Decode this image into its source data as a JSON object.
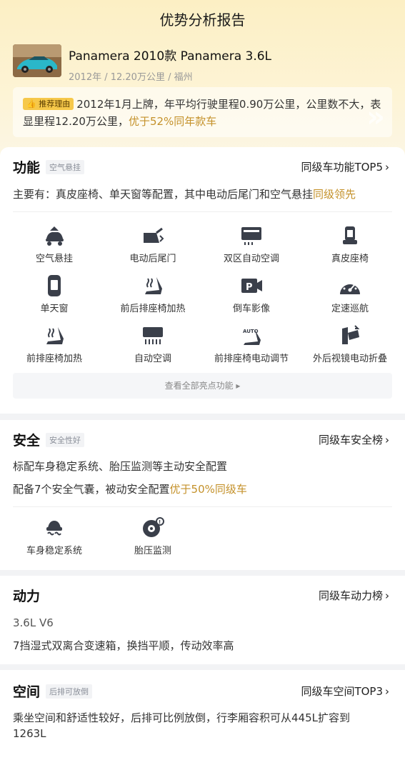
{
  "page": {
    "title": "优势分析报告"
  },
  "car": {
    "name": "Panamera 2010款 Panamera 3.6L",
    "meta": "2012年 / 12.20万公里 / 福州"
  },
  "reason": {
    "tag": "推荐理由",
    "text": "2012年1月上牌，年平均行驶里程0.90万公里，公里数不大，表显里程12.20万公里，",
    "highlight": "优于52%同年款车"
  },
  "features": {
    "title": "功能",
    "tag": "空气悬挂",
    "link": "同级车功能TOP5",
    "summary_prefix": "主要有：真皮座椅、单天窗等配置，其中电动后尾门和空气悬挂",
    "summary_highlight": "同级领先",
    "items": [
      {
        "label": "空气悬挂",
        "icon": "air-suspension-icon"
      },
      {
        "label": "电动后尾门",
        "icon": "power-tailgate-icon"
      },
      {
        "label": "双区自动空调",
        "icon": "dual-zone-ac-icon"
      },
      {
        "label": "真皮座椅",
        "icon": "leather-seat-icon"
      },
      {
        "label": "单天窗",
        "icon": "sunroof-icon"
      },
      {
        "label": "前后排座椅加热",
        "icon": "seat-heating-icon"
      },
      {
        "label": "倒车影像",
        "icon": "reverse-camera-icon"
      },
      {
        "label": "定速巡航",
        "icon": "cruise-control-icon"
      },
      {
        "label": "前排座椅加热",
        "icon": "front-seat-heating-icon"
      },
      {
        "label": "自动空调",
        "icon": "auto-ac-icon"
      },
      {
        "label": "前排座椅电动调节",
        "icon": "power-seat-icon"
      },
      {
        "label": "外后视镜电动折叠",
        "icon": "mirror-fold-icon"
      }
    ],
    "more": "查看全部亮点功能 ▸"
  },
  "safety": {
    "title": "安全",
    "tag": "安全性好",
    "link": "同级车安全榜",
    "line1": "标配车身稳定系统、胎压监测等主动安全配置",
    "line2_prefix": "配备7个安全气囊，被动安全配置",
    "line2_highlight": "优于50%同级车",
    "items": [
      {
        "label": "车身稳定系统",
        "icon": "stability-control-icon"
      },
      {
        "label": "胎压监测",
        "icon": "tire-pressure-icon"
      }
    ]
  },
  "power": {
    "title": "动力",
    "link": "同级车动力榜",
    "engine": "3.6L V6",
    "transmission": "7挡湿式双离合变速箱，换挡平顺，传动效率高"
  },
  "space": {
    "title": "空间",
    "tag": "后排可放倒",
    "link": "同级车空间TOP3",
    "text": "乘坐空间和舒适性较好，后排可比例放倒，行李厢容积可从445L扩容到1263L"
  },
  "colors": {
    "accent": "#c4912a",
    "tag_bg": "#f6c84a"
  }
}
